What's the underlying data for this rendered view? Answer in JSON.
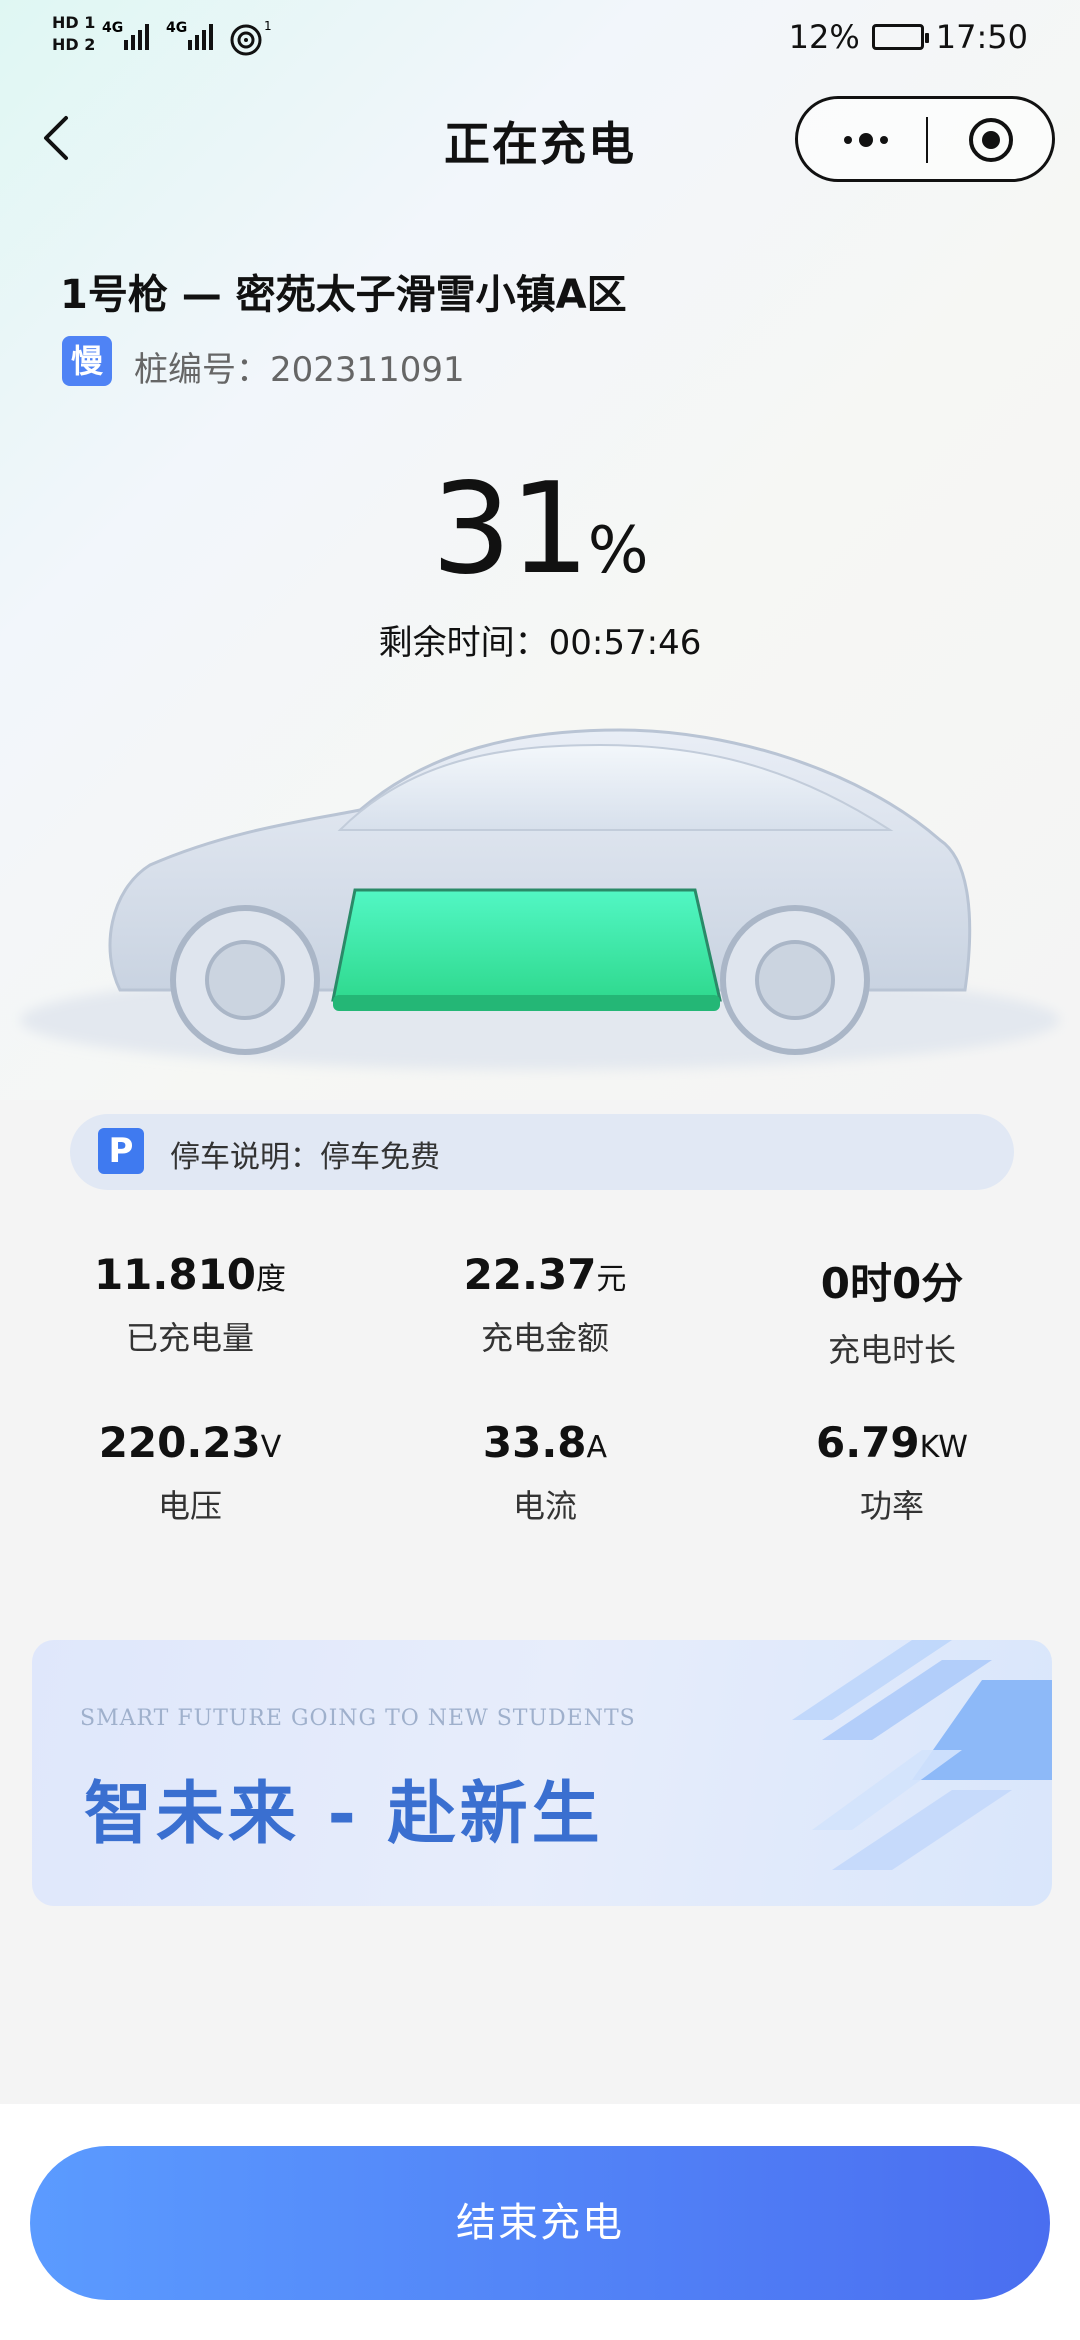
{
  "status_bar": {
    "sim1": "HD 1",
    "sim2": "HD 2",
    "network1": "4G",
    "network2": "4G",
    "hotspot_count": "1",
    "battery_percent": "12%",
    "time": "17:50"
  },
  "nav": {
    "title": "正在充电",
    "back_icon": "chevron-left-icon",
    "more_icon": "more-dots-icon",
    "close_icon": "target-circle-icon"
  },
  "station": {
    "title": "1号枪 — 密苑太子滑雪小镇A区",
    "speed_badge": "慢",
    "pile_label": "桩编号：202311091"
  },
  "charging": {
    "percent_value": "31",
    "percent_unit": "%",
    "remaining_time": "剩余时间：00:57:46",
    "battery_fill": 0.31
  },
  "parking": {
    "icon_text": "P",
    "text": "停车说明：停车免费"
  },
  "stats": [
    {
      "value": "11.810",
      "unit": "度",
      "label": "已充电量"
    },
    {
      "value": "22.37",
      "unit": "元",
      "label": "充电金额"
    },
    {
      "value": "0时0分",
      "unit": "",
      "label": "充电时长"
    },
    {
      "value": "220.23",
      "unit": "V",
      "label": "电压"
    },
    {
      "value": "33.8",
      "unit": "A",
      "label": "电流"
    },
    {
      "value": "6.79",
      "unit": "KW",
      "label": "功率"
    }
  ],
  "banner": {
    "subtitle": "SMART FUTURE GOING TO NEW STUDENTS",
    "title": "智未来 - 赴新生"
  },
  "actions": {
    "end_charging": "结束充电"
  },
  "colors": {
    "accent": "#4f83f5",
    "battery_green": "#3fe7a8",
    "button_start": "#5b9bff",
    "button_end": "#4a6ef0"
  }
}
